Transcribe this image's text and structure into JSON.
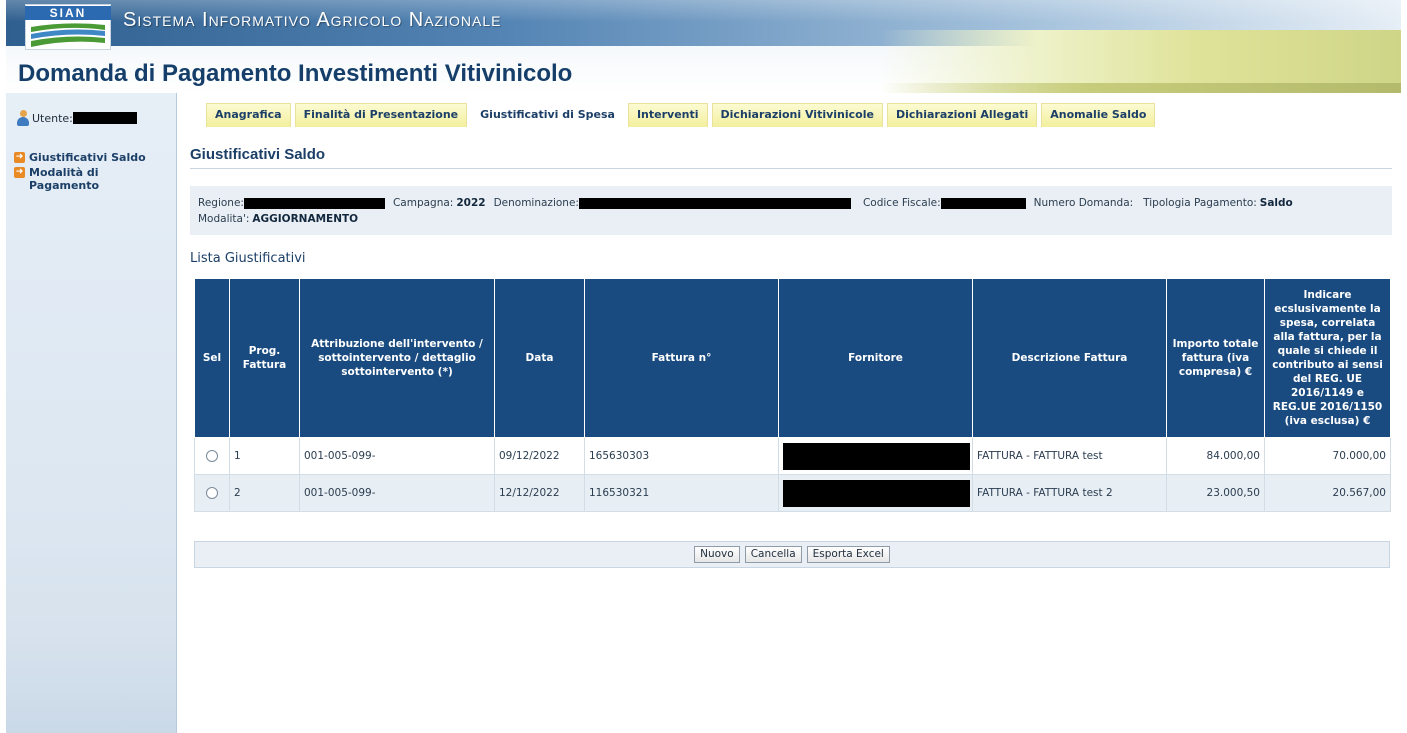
{
  "header": {
    "logo_text": "SIAN",
    "system_name": "Sistema Informativo Agricolo Nazionale",
    "page_title": "Domanda di Pagamento Investimenti Vitivinicolo"
  },
  "sidebar": {
    "user_label": "Utente:",
    "items": [
      {
        "label": "Giustificativi Saldo"
      },
      {
        "label": "Modalità di Pagamento"
      }
    ]
  },
  "tabs": [
    {
      "label": "Anagrafica"
    },
    {
      "label": "Finalità di Presentazione"
    },
    {
      "label": "Giustificativi di Spesa",
      "active": true
    },
    {
      "label": "Interventi"
    },
    {
      "label": "Dichiarazioni Vitivinicole"
    },
    {
      "label": "Dichiarazioni Allegati"
    },
    {
      "label": "Anomalie Saldo"
    }
  ],
  "section_title": "Giustificativi Saldo",
  "info": {
    "regione_label": "Regione:",
    "campagna_label": "Campagna:",
    "campagna_value": "2022",
    "denominazione_label": "Denominazione:",
    "codice_fiscale_label": "Codice Fiscale:",
    "numero_domanda_label": "Numero Domanda:",
    "tipologia_label": "Tipologia Pagamento:",
    "tipologia_value": "Saldo",
    "modalita_label": "Modalita':",
    "modalita_value": "AGGIORNAMENTO"
  },
  "list_title": "Lista Giustificativi",
  "table": {
    "headers": {
      "sel": "Sel",
      "prog": "Prog. Fattura",
      "attribuzione": "Attribuzione dell'intervento / sottointervento / dettaglio sottointervento (*)",
      "data": "Data",
      "fattura": "Fattura n°",
      "fornitore": "Fornitore",
      "descrizione": "Descrizione Fattura",
      "importo": "Importo totale fattura (iva compresa) €",
      "spesa": "Indicare ecslusivamente la spesa, correlata alla fattura, per la quale si chiede il contributo ai sensi del REG. UE 2016/1149 e REG.UE 2016/1150 (iva esclusa) €"
    },
    "rows": [
      {
        "prog": "1",
        "attribuzione": "001-005-099-",
        "data": "09/12/2022",
        "fattura": "165630303",
        "descrizione": "FATTURA - FATTURA test",
        "importo": "84.000,00",
        "spesa": "70.000,00"
      },
      {
        "prog": "2",
        "attribuzione": "001-005-099-",
        "data": "12/12/2022",
        "fattura": "116530321",
        "descrizione": "FATTURA - FATTURA test 2",
        "importo": "23.000,50",
        "spesa": "20.567,00"
      }
    ]
  },
  "buttons": {
    "nuovo": "Nuovo",
    "cancella": "Cancella",
    "esporta": "Esporta Excel"
  }
}
